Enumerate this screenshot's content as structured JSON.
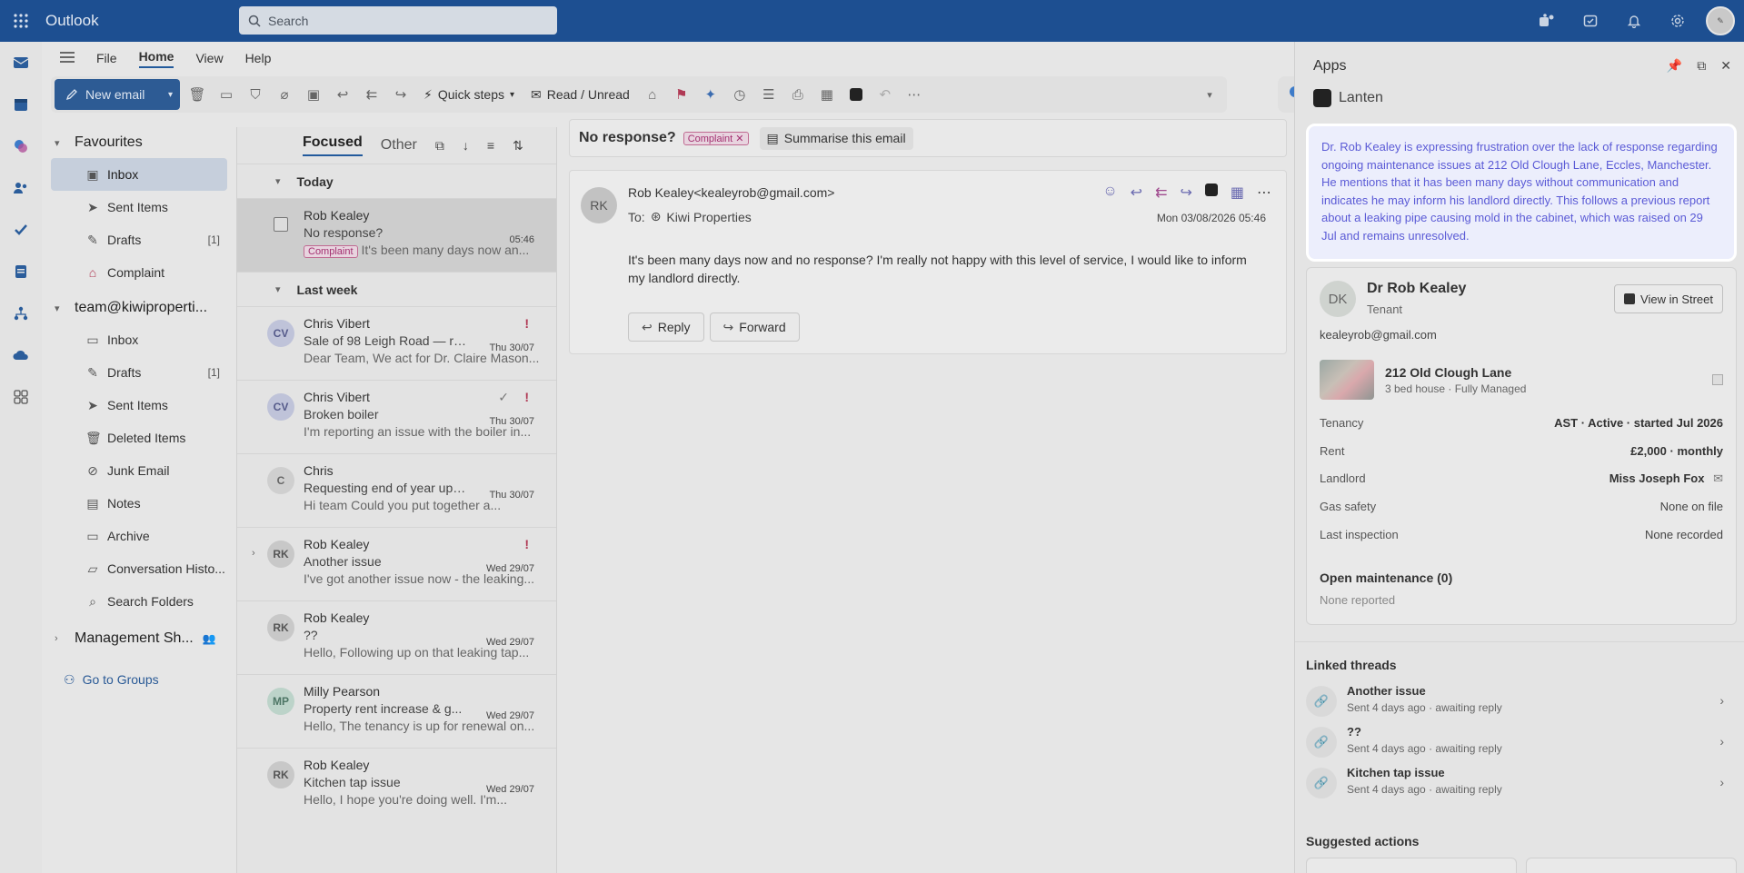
{
  "app": {
    "title": "Outlook"
  },
  "search": {
    "placeholder": "Search"
  },
  "menu": {
    "file": "File",
    "home": "Home",
    "view": "View",
    "help": "Help"
  },
  "toolbar": {
    "new_email": "New email",
    "quick_steps": "Quick steps",
    "read_unread": "Read / Unread"
  },
  "folders": {
    "favourites": "Favourites",
    "fav_items": [
      {
        "label": "Inbox",
        "count": ""
      },
      {
        "label": "Sent Items",
        "count": ""
      },
      {
        "label": "Drafts",
        "count": "[1]"
      },
      {
        "label": "Complaint",
        "count": ""
      }
    ],
    "account": "team@kiwipropert​i...",
    "acc_items": [
      {
        "label": "Inbox",
        "count": ""
      },
      {
        "label": "Drafts",
        "count": "[1]"
      },
      {
        "label": "Sent Items",
        "count": ""
      },
      {
        "label": "Deleted Items",
        "count": ""
      },
      {
        "label": "Junk Email",
        "count": ""
      },
      {
        "label": "Notes",
        "count": ""
      },
      {
        "label": "Archive",
        "count": ""
      },
      {
        "label": "Conversation Histo...",
        "count": ""
      },
      {
        "label": "Search Folders",
        "count": ""
      }
    ],
    "management": "Management Sh...",
    "go_to_groups": "Go to Groups"
  },
  "list": {
    "focused": "Focused",
    "other": "Other",
    "group_today": "Today",
    "group_last_week": "Last week",
    "selected": {
      "sender": "Rob Kealey",
      "subject": "No response?",
      "date": "05:46",
      "tag": "Complaint",
      "preview": "It's been many days now an..."
    },
    "messages": [
      {
        "initials": "CV",
        "sender": "Chris Vibert",
        "subject": "Sale of 98 Leigh Road — re...",
        "date": "Thu 30/07",
        "preview": "Dear Team, We act for Dr. Claire Mason...",
        "avatar_bg": "#bfc3d9",
        "avatar_fg": "#555a8a"
      },
      {
        "initials": "CV",
        "sender": "Chris Vibert",
        "subject": "Broken boiler",
        "date": "Thu 30/07",
        "preview": "I'm reporting an issue with the boiler in...",
        "avatar_bg": "#bfc3d9",
        "avatar_fg": "#555a8a"
      },
      {
        "initials": "C",
        "sender": "Chris",
        "subject": "Requesting end of year upd...",
        "date": "Thu 30/07",
        "preview": "Hi team Could you put together a...",
        "avatar_bg": "#cfcfcf",
        "avatar_fg": "#666666"
      },
      {
        "initials": "RK",
        "sender": "Rob Kealey",
        "subject": "Another issue",
        "date": "Wed 29/07",
        "preview": "I've got another issue now - the leaking...",
        "avatar_bg": "#c8c8c8",
        "avatar_fg": "#555555"
      },
      {
        "initials": "RK",
        "sender": "Rob Kealey",
        "subject": "??",
        "date": "Wed 29/07",
        "preview": "Hello, Following up on that leaking tap...",
        "avatar_bg": "#c8c8c8",
        "avatar_fg": "#555555"
      },
      {
        "initials": "MP",
        "sender": "Milly Pearson",
        "subject": "Property rent increase & g...",
        "date": "Wed 29/07",
        "preview": "Hello, The tenancy is up for renewal on...",
        "avatar_bg": "#bcd3c9",
        "avatar_fg": "#4d7565"
      },
      {
        "initials": "RK",
        "sender": "Rob Kealey",
        "subject": "Kitchen tap issue",
        "date": "Wed 29/07",
        "preview": "Hello, I hope you're doing well. I'm...",
        "avatar_bg": "#c8c8c8",
        "avatar_fg": "#555555"
      }
    ]
  },
  "reading": {
    "subject": "No response?",
    "tag": "Complaint",
    "summarise": "Summarise this email",
    "avatar": "RK",
    "from": "Rob Kealey<kealeyrob@gmail.com>",
    "to_label": "To:",
    "to": "Kiwi Properties",
    "date": "Mon 03/08/2026 05:46",
    "body": "It's been many days now and no response? I'm really not happy with this level of service, I would like to inform my landlord directly.",
    "reply": "Reply",
    "forward": "Forward"
  },
  "apps": {
    "title": "Apps",
    "addin": "Lanten",
    "summary": "Dr. Rob Kealey is expressing frustration over the lack of response regarding ongoing maintenance issues at 212 Old Clough Lane, Eccles, Manchester. He mentions that it has been many days without communication and indicates he may inform his landlord directly. This follows a previous report about a leaking pipe causing mold in the cabinet, which was raised on 29 Jul and remains unresolved.",
    "tenant": {
      "initials": "DK",
      "name": "Dr Rob Kealey",
      "role": "Tenant",
      "email": "kealeyrob@gmail.com",
      "view_in_street": "View in Street"
    },
    "property": {
      "name": "212 Old Clough Lane",
      "desc": "3 bed house · Fully Managed"
    },
    "details": [
      {
        "k": "Tenancy",
        "v": "AST · Active · started Jul 2026"
      },
      {
        "k": "Rent",
        "v": "£2,000 · monthly"
      },
      {
        "k": "Landlord",
        "v": "Miss Joseph Fox"
      },
      {
        "k": "Gas safety",
        "v": "None on file"
      },
      {
        "k": "Last inspection",
        "v": "None recorded"
      }
    ],
    "open_maintenance": "Open maintenance (0)",
    "none_reported": "None reported",
    "linked_threads": "Linked threads",
    "threads": [
      {
        "title": "Another issue",
        "sub": "Sent 4 days ago · awaiting reply"
      },
      {
        "title": "??",
        "sub": "Sent 4 days ago · awaiting reply"
      },
      {
        "title": "Kitchen tap issue",
        "sub": "Sent 4 days ago · awaiting reply"
      }
    ],
    "suggested_actions": "Suggested actions"
  }
}
